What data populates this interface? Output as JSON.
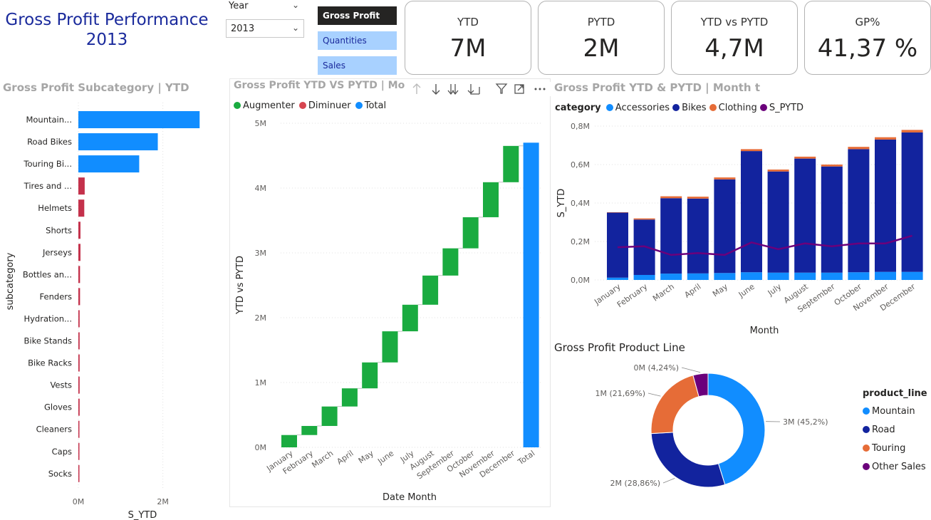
{
  "report": {
    "title_line1": "Gross Profit Performance",
    "title_line2": "2013"
  },
  "slicer": {
    "label": "Year",
    "selected": "2013"
  },
  "buttons": [
    {
      "label": "Gross Profit",
      "active": true
    },
    {
      "label": "Quantities",
      "active": false
    },
    {
      "label": "Sales",
      "active": false
    }
  ],
  "cards": [
    {
      "label": "YTD",
      "value": "7M"
    },
    {
      "label": "PYTD",
      "value": "2M"
    },
    {
      "label": "YTD vs PYTD",
      "value": "4,7M"
    },
    {
      "label": "GP%",
      "value": "41,37 %"
    }
  ],
  "colors": {
    "blue": "#118dff",
    "navy": "#12239e",
    "orange": "#e66c37",
    "purple": "#6b007b",
    "green": "#1aab40",
    "red": "#d64550",
    "darkred": "#c4314b",
    "title_navy": "#1a2a9c"
  },
  "subcategory_chart": {
    "title": "Gross Profit Subcategory | YTD",
    "chart_data": {
      "type": "bar",
      "orientation": "horizontal",
      "categories": [
        "Mountain...",
        "Road Bikes",
        "Touring Bi...",
        "Tires and ...",
        "Helmets",
        "Shorts",
        "Jerseys",
        "Bottles an...",
        "Fenders",
        "Hydration...",
        "Bike Stands",
        "Bike Racks",
        "Vests",
        "Gloves",
        "Cleaners",
        "Caps",
        "Socks"
      ],
      "values": [
        2.87,
        1.88,
        1.44,
        0.15,
        0.14,
        0.05,
        0.05,
        0.04,
        0.04,
        0.03,
        0.03,
        0.03,
        0.03,
        0.03,
        0.02,
        0.02,
        0.01
      ],
      "colors": [
        "#118dff",
        "#118dff",
        "#118dff",
        "#c4314b",
        "#c4314b",
        "#c4314b",
        "#c4314b",
        "#c4314b",
        "#c4314b",
        "#c4314b",
        "#c4314b",
        "#c4314b",
        "#c4314b",
        "#c4314b",
        "#c4314b",
        "#c4314b",
        "#c4314b"
      ],
      "xlabel": "S_YTD",
      "ylabel": "subcategory",
      "xticks": [
        "0M",
        "2M"
      ],
      "xlim": [
        0,
        2.95
      ],
      "unit": "M",
      "grid": true
    }
  },
  "waterfall_chart": {
    "title": "Gross Profit YTD VS PYTD | Month - C",
    "toolbar": [
      "filter-icon",
      "focus-mode-icon",
      "more-options-icon"
    ],
    "chart_data": {
      "type": "bar",
      "subtype": "waterfall",
      "categories": [
        "January",
        "February",
        "March",
        "April",
        "May",
        "June",
        "July",
        "August",
        "September",
        "October",
        "November",
        "December",
        "Total"
      ],
      "deltas": [
        0.19,
        0.14,
        0.3,
        0.28,
        0.4,
        0.48,
        0.41,
        0.45,
        0.42,
        0.48,
        0.54,
        0.56
      ],
      "total": 4.7,
      "legend": [
        "Augmenter",
        "Diminuer",
        "Total"
      ],
      "yticks": [
        "0M",
        "1M",
        "2M",
        "3M",
        "4M",
        "5M"
      ],
      "ylim": [
        0,
        5
      ],
      "unit": "M",
      "xlabel": "Date Month",
      "ylabel": "YTD vs PYTD",
      "grid": true
    }
  },
  "stacked_chart": {
    "title": "Gross Profit YTD & PYTD | Month t",
    "legend_title": "category",
    "chart_data": {
      "type": "bar",
      "subtype": "stacked-column-with-line",
      "categories": [
        "January",
        "February",
        "March",
        "April",
        "May",
        "June",
        "July",
        "August",
        "September",
        "October",
        "November",
        "December"
      ],
      "series": [
        {
          "name": "Accessories",
          "type": "bar",
          "values": [
            0.012,
            0.026,
            0.033,
            0.034,
            0.036,
            0.04,
            0.038,
            0.038,
            0.038,
            0.04,
            0.042,
            0.042
          ]
        },
        {
          "name": "Bikes",
          "type": "bar",
          "values": [
            0.338,
            0.288,
            0.392,
            0.389,
            0.487,
            0.63,
            0.526,
            0.593,
            0.552,
            0.64,
            0.688,
            0.725
          ]
        },
        {
          "name": "Clothing",
          "type": "bar",
          "values": [
            0.002,
            0.006,
            0.01,
            0.01,
            0.01,
            0.01,
            0.01,
            0.01,
            0.01,
            0.012,
            0.012,
            0.013
          ]
        },
        {
          "name": "S_PYTD",
          "type": "line",
          "values": [
            0.17,
            0.175,
            0.13,
            0.14,
            0.13,
            0.195,
            0.16,
            0.19,
            0.175,
            0.19,
            0.19,
            0.23
          ]
        }
      ],
      "yticks": [
        "0,0M",
        "0,2M",
        "0,4M",
        "0,6M",
        "0,8M"
      ],
      "ylim": [
        0,
        0.8
      ],
      "unit": "M",
      "xlabel": "Month",
      "ylabel": "S_YTD",
      "grid": true
    }
  },
  "donut_chart": {
    "title": "Gross Profit Product Line",
    "legend_title": "product_line",
    "chart_data": {
      "type": "pie",
      "subtype": "donut",
      "labels": [
        "Mountain",
        "Road",
        "Touring",
        "Other Sales"
      ],
      "values": [
        45.2,
        28.86,
        21.69,
        4.24
      ],
      "data_labels": [
        "3M (45,2%)",
        "2M (28,86%)",
        "1M (21,69%)",
        "0M (4,24%)"
      ],
      "colors": [
        "#118dff",
        "#12239e",
        "#e66c37",
        "#6b007b"
      ]
    }
  }
}
